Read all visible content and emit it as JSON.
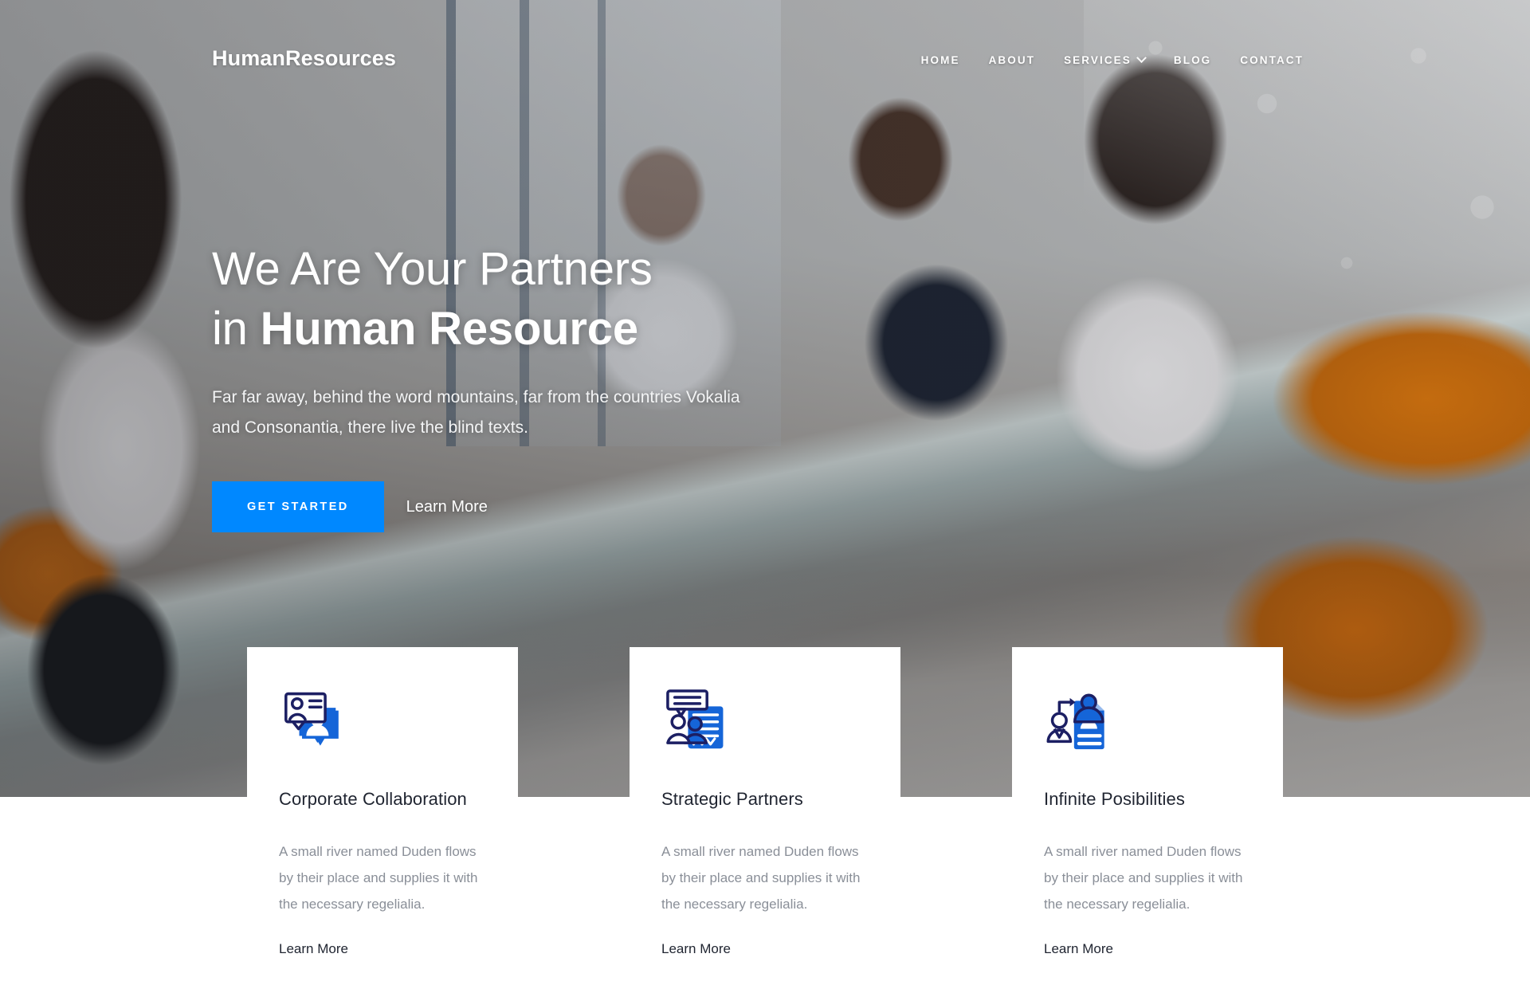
{
  "brand": {
    "name": "HumanResources"
  },
  "nav": {
    "items": [
      {
        "label": "HOME",
        "name": "nav-home",
        "has_chevron": false
      },
      {
        "label": "ABOUT",
        "name": "nav-about",
        "has_chevron": false
      },
      {
        "label": "SERVICES",
        "name": "nav-services",
        "has_chevron": true
      },
      {
        "label": "BLOG",
        "name": "nav-blog",
        "has_chevron": false
      },
      {
        "label": "CONTACT",
        "name": "nav-contact",
        "has_chevron": false
      }
    ]
  },
  "hero": {
    "title_line1": "We Are Your Partners",
    "title_line2_prefix": "in ",
    "title_line2_strong": "Human Resource",
    "subtitle": "Far far away, behind the word mountains, far from the countries Vokalia and Consonantia, there live the blind texts.",
    "primary_button": "GET STARTED",
    "secondary_link": "Learn More"
  },
  "cards": [
    {
      "icon": "people-chat-bubbles-icon",
      "title": "Corporate Collaboration",
      "text": "A small river named Duden flows by their place and supplies it with the necessary regelialia.",
      "link": "Learn More"
    },
    {
      "icon": "person-chat-document-icon",
      "title": "Strategic Partners",
      "text": "A small river named Duden flows by their place and supplies it with the necessary regelialia.",
      "link": "Learn More"
    },
    {
      "icon": "person-transfer-resume-icon",
      "title": "Infinite Posibilities",
      "text": "A small river named Duden flows by their place and supplies it with the necessary regelialia.",
      "link": "Learn More"
    }
  ],
  "colors": {
    "accent_blue": "#0088ff",
    "icon_blue": "#1565d8",
    "icon_navy": "#1c1f63",
    "heading": "#1f2430",
    "body_text": "#8a8f98",
    "card_bg": "#ffffff"
  }
}
